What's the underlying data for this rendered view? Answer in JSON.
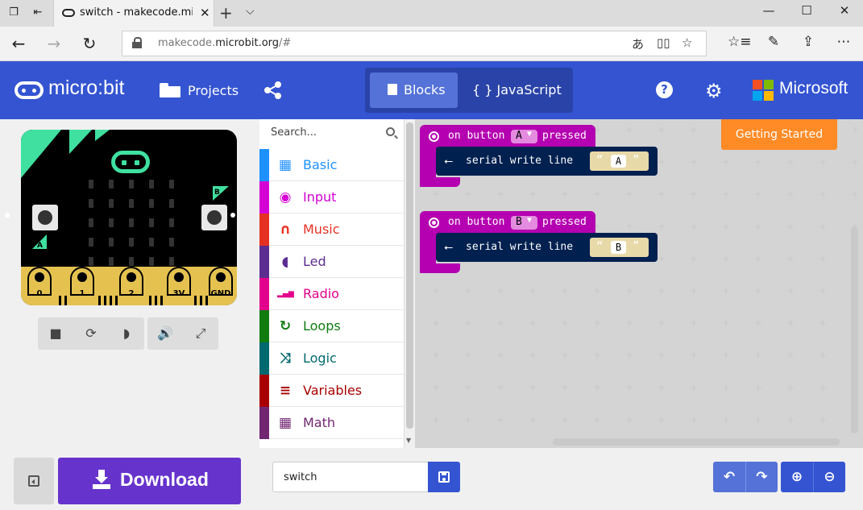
{
  "browser": {
    "tab_title": "switch - makecode.micr",
    "url_host": "makecode.",
    "url_domain": "microbit.org",
    "url_path": "/#"
  },
  "header": {
    "logo_text": "micro:bit",
    "projects_label": "Projects",
    "blocks_label": "Blocks",
    "javascript_label": "{ } JavaScript",
    "microsoft_label": "Microsoft",
    "accent": "#3454d1"
  },
  "simulator": {
    "pins": [
      "0",
      "1",
      "2",
      "3V",
      "GND"
    ],
    "button_a": "A",
    "button_b": "B"
  },
  "toolbox": {
    "search_placeholder": "Search...",
    "categories": [
      {
        "label": "Basic",
        "color": "#1e90ff",
        "icon": "grid-icon"
      },
      {
        "label": "Input",
        "color": "#d400d4",
        "icon": "input-icon"
      },
      {
        "label": "Music",
        "color": "#e63022",
        "icon": "headphones-icon"
      },
      {
        "label": "Led",
        "color": "#5c2d91",
        "icon": "toggle-icon"
      },
      {
        "label": "Radio",
        "color": "#e3008c",
        "icon": "signal-icon"
      },
      {
        "label": "Loops",
        "color": "#107c10",
        "icon": "refresh-icon"
      },
      {
        "label": "Logic",
        "color": "#006970",
        "icon": "shuffle-icon"
      },
      {
        "label": "Variables",
        "color": "#a80000",
        "icon": "list-icon"
      },
      {
        "label": "Math",
        "color": "#712672",
        "icon": "calculator-icon"
      }
    ]
  },
  "workspace": {
    "getting_started": "Getting Started",
    "blocks": [
      {
        "event_prefix": "on button",
        "button": "A",
        "event_suffix": "pressed",
        "statement": "serial write line",
        "value": "A"
      },
      {
        "event_prefix": "on button",
        "button": "B",
        "event_suffix": "pressed",
        "statement": "serial write line",
        "value": "B"
      }
    ]
  },
  "bottom": {
    "download_label": "Download",
    "project_name": "switch"
  }
}
